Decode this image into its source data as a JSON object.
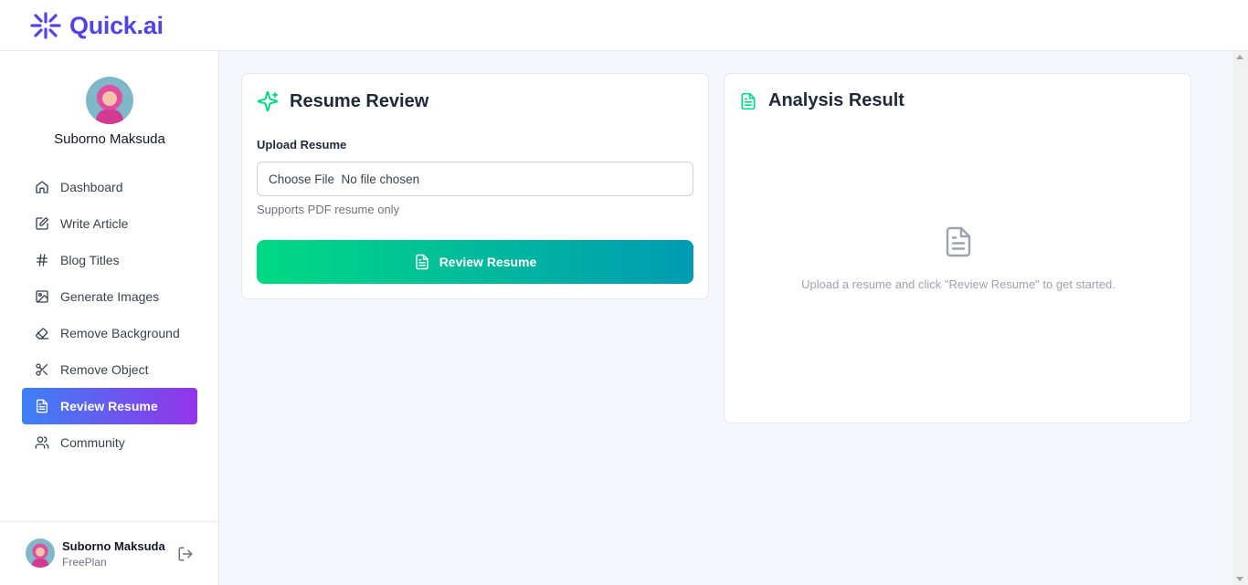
{
  "app": {
    "name": "Quick.ai",
    "brand_color": "#5044e5",
    "logo_icon": "sparkle-logo-icon"
  },
  "user": {
    "name": "Suborno Maksuda",
    "plan": "FreePlan"
  },
  "sidebar": {
    "items": [
      {
        "label": "Dashboard",
        "icon": "home-icon",
        "active": false
      },
      {
        "label": "Write Article",
        "icon": "edit-icon",
        "active": false
      },
      {
        "label": "Blog Titles",
        "icon": "hash-icon",
        "active": false
      },
      {
        "label": "Generate Images",
        "icon": "image-icon",
        "active": false
      },
      {
        "label": "Remove Background",
        "icon": "eraser-icon",
        "active": false
      },
      {
        "label": "Remove Object",
        "icon": "scissors-icon",
        "active": false
      },
      {
        "label": "Review Resume",
        "icon": "file-text-icon",
        "active": true
      },
      {
        "label": "Community",
        "icon": "users-icon",
        "active": false
      }
    ],
    "active_gradient": [
      "#3c81f6",
      "#9234ea"
    ]
  },
  "resume_review": {
    "title": "Resume Review",
    "upload_label": "Upload Resume",
    "file_input_value": "Choose File  No file chosen",
    "hint": "Supports PDF resume only",
    "button_label": "Review Resume",
    "accent_color": "#00da83"
  },
  "analysis": {
    "title": "Analysis Result",
    "empty_message": "Upload a resume and click \"Review Resume\" to get started."
  }
}
